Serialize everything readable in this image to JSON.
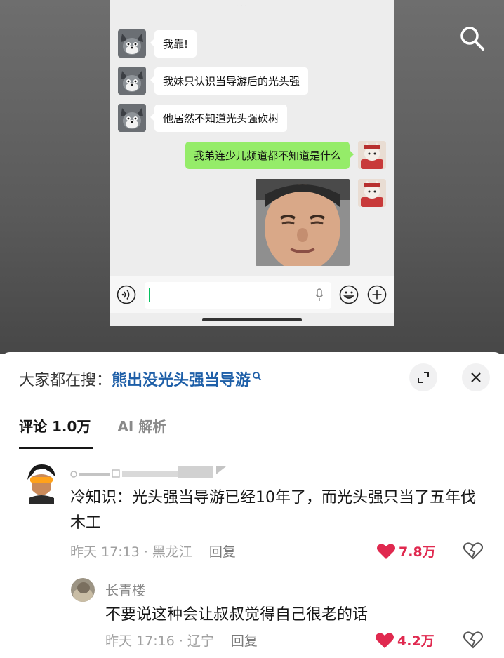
{
  "chat": {
    "messages": [
      {
        "side": "left",
        "text": "我靠!"
      },
      {
        "side": "left",
        "text": "我妹只认识当导游后的光头强"
      },
      {
        "side": "left",
        "text": "他居然不知道光头强砍树"
      },
      {
        "side": "right",
        "text": "我弟连少儿频道都不知道是什么"
      }
    ]
  },
  "panel": {
    "search_prefix": "大家都在搜：",
    "search_keyword": "熊出没光头强当导游",
    "tabs": [
      "评论 1.0万",
      "AI 解析"
    ]
  },
  "comments": [
    {
      "text": "冷知识：光头强当导游已经10年了，而光头强只当了五年伐木工",
      "time_location": "昨天 17:13 · 黑龙江",
      "reply_label": "回复",
      "likes": "7.8万"
    },
    {
      "username": "长青楼",
      "text": "不要说这种会让叔叔觉得自己很老的话",
      "time_location": "昨天 17:16 · 辽宁",
      "reply_label": "回复",
      "likes": "4.2万"
    }
  ],
  "colors": {
    "accent_blue": "#1e5fa8",
    "like_red": "#e0294f",
    "wechat_green": "#95ec69"
  }
}
